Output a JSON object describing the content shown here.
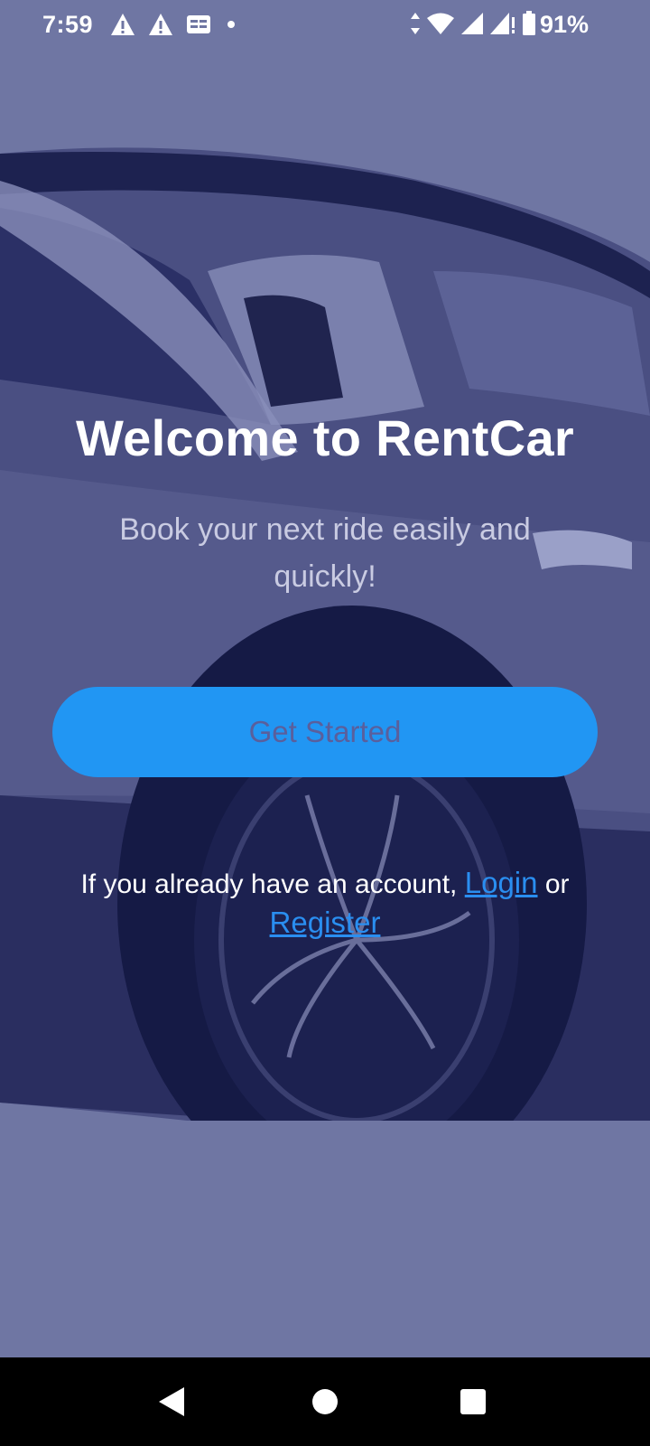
{
  "status_bar": {
    "time": "7:59",
    "battery": "91%",
    "icons": [
      "warning-icon",
      "warning-icon",
      "cast-icon",
      "dot-icon",
      "data-arrows-icon",
      "wifi-icon",
      "signal-icon",
      "signal-icon",
      "battery-icon"
    ]
  },
  "hero": {
    "title": "Welcome to RentCar",
    "subtitle": "Book your next ride easily and quickly!"
  },
  "cta": {
    "get_started": "Get Started"
  },
  "account": {
    "prefix": "If you already have an account,",
    "login": "Login",
    "or": "or",
    "register": "Register"
  },
  "nav": {
    "icons": [
      "back-icon",
      "home-icon",
      "recents-icon"
    ]
  },
  "colors": {
    "overlay": "#6f76a3",
    "button": "#2196f3",
    "button_text": "#5a5f9c",
    "link": "#2a8ef0"
  }
}
